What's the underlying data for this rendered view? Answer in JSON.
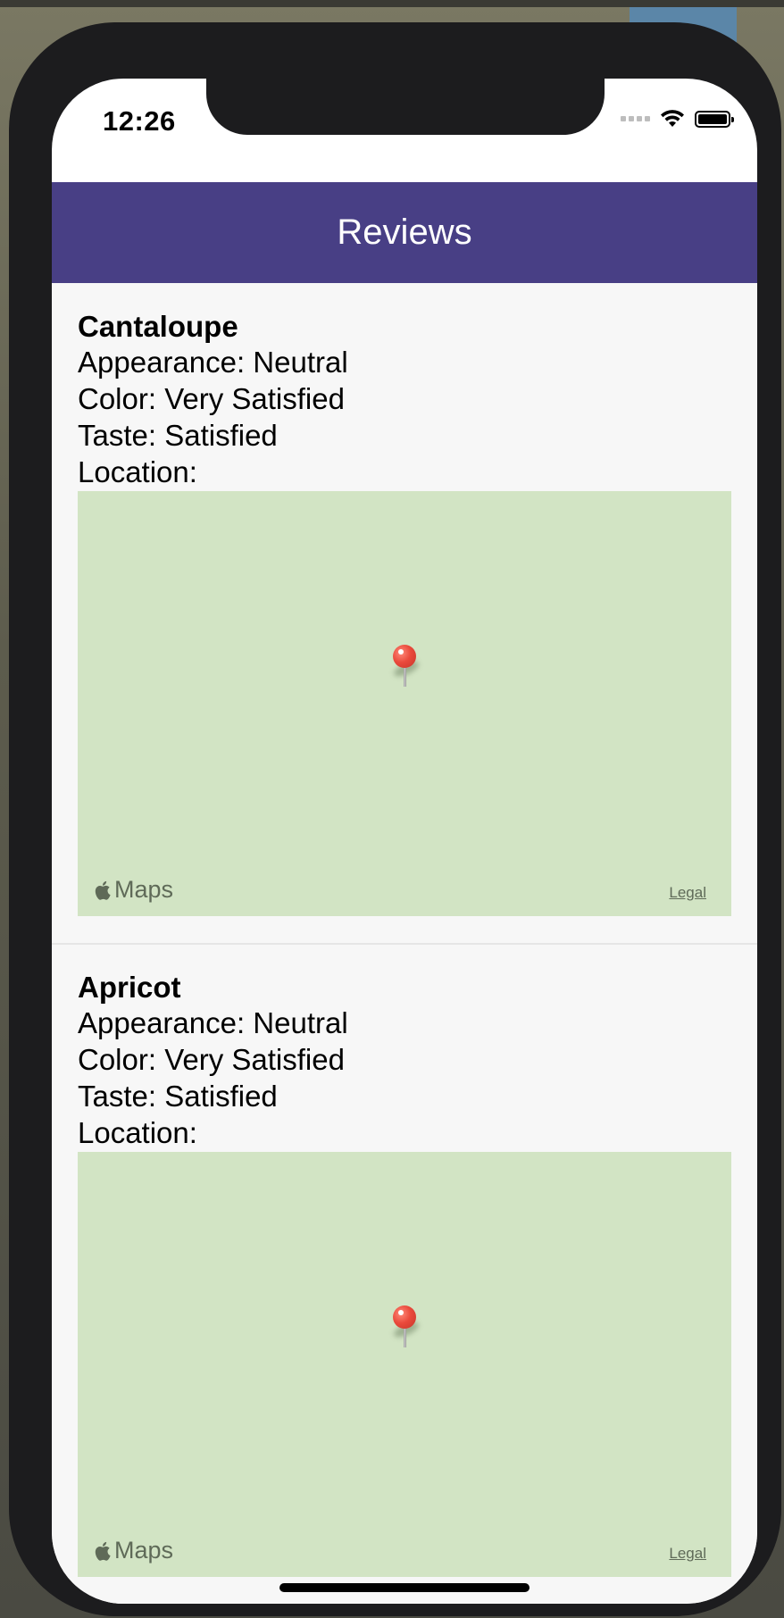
{
  "status_bar": {
    "time": "12:26"
  },
  "nav": {
    "title": "Reviews"
  },
  "reviews": [
    {
      "name": "Cantaloupe",
      "appearance": "Appearance: Neutral",
      "color": "Color: Very Satisfied",
      "taste": "Taste: Satisfied",
      "location_label": "Location:",
      "map_brand": "Maps",
      "map_legal": "Legal"
    },
    {
      "name": "Apricot",
      "appearance": "Appearance: Neutral",
      "color": "Color: Very Satisfied",
      "taste": "Taste: Satisfied",
      "location_label": "Location:",
      "map_brand": "Maps",
      "map_legal": "Legal"
    }
  ],
  "colors": {
    "nav_background": "#483f85",
    "map_background": "#d2e4c4",
    "pin": "#ea4a3c"
  },
  "icons": {
    "map_pin": "map-pin-icon",
    "apple_logo": "apple-icon",
    "wifi": "wifi-icon",
    "battery": "battery-icon",
    "signal": "cellular-signal-icon"
  }
}
